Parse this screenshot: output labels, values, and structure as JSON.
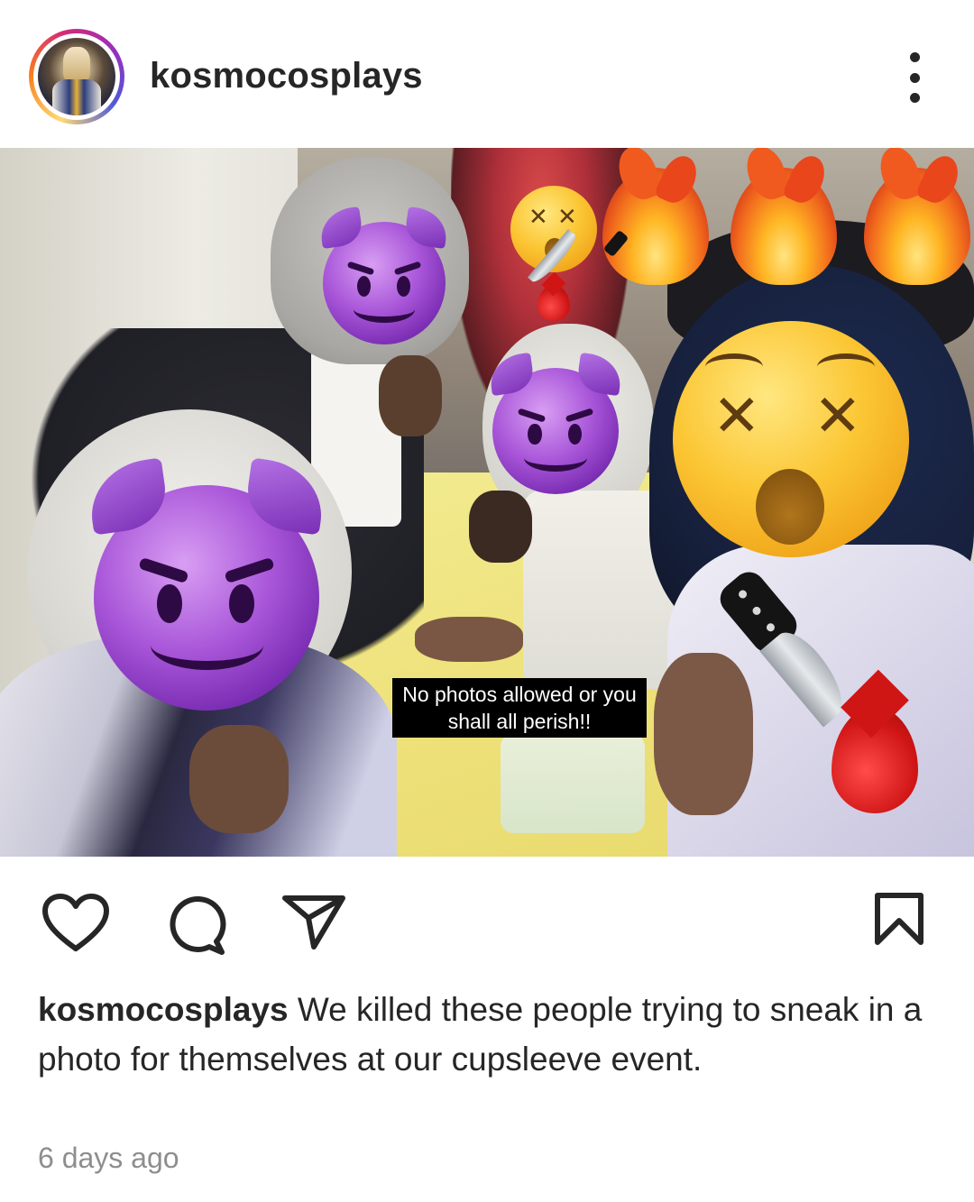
{
  "post": {
    "username": "kosmocosplays",
    "photo_overlay_text": "No photos allowed or you shall all perish!!",
    "caption_username": "kosmocosplays",
    "caption_text": "We killed these people trying to sneak in a photo for themselves at our cupsleeve event.",
    "timestamp": "6 days ago"
  },
  "icons": {
    "more": "more-options-icon",
    "like": "heart-icon",
    "comment": "comment-icon",
    "share": "send-icon",
    "save": "bookmark-icon"
  },
  "colors": {
    "text": "#262626",
    "muted": "#8e8e8e",
    "background": "#ffffff"
  }
}
